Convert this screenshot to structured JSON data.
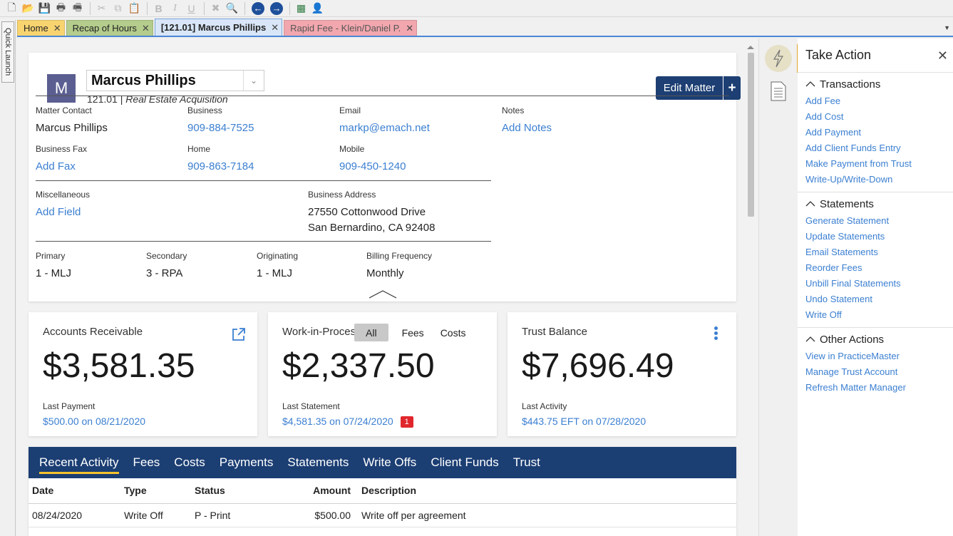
{
  "toolbar": {
    "buttons": [
      "new-doc-icon",
      "open-folder-icon",
      "save-icon",
      "print-icon",
      "print-multi-icon",
      "cut-icon",
      "copy-icon",
      "paste-icon",
      "bold-icon",
      "italic-icon",
      "underline-icon",
      "delete-icon",
      "find-icon",
      "back-arrow-icon",
      "forward-arrow-icon",
      "grid-icon",
      "user-key-icon"
    ]
  },
  "quick_launch": "Quick Launch",
  "tabs": [
    {
      "label": "Home"
    },
    {
      "label": "Recap of Hours"
    },
    {
      "label": "[121.01] Marcus Phillips"
    },
    {
      "label": "Rapid Fee - Klein/Daniel P."
    }
  ],
  "close_glyph": "✕",
  "matter": {
    "avatar": "M",
    "client_name": "Marcus Phillips",
    "number": "121.01",
    "separator": " | ",
    "description": "Real Estate Acquisition",
    "edit_label": "Edit Matter",
    "add_label": "+"
  },
  "contact": {
    "matter_contact": {
      "label": "Matter Contact",
      "value": "Marcus Phillips"
    },
    "business": {
      "label": "Business",
      "value": "909-884-7525"
    },
    "email": {
      "label": "Email",
      "value": "markp@emach.net"
    },
    "notes": {
      "label": "Notes",
      "value": "Add Notes"
    },
    "business_fax": {
      "label": "Business Fax",
      "value": "Add Fax"
    },
    "home": {
      "label": "Home",
      "value": "909-863-7184"
    },
    "mobile": {
      "label": "Mobile",
      "value": "909-450-1240"
    },
    "misc": {
      "label": "Miscellaneous",
      "value": "Add Field"
    },
    "address": {
      "label": "Business Address",
      "line1": "27550 Cottonwood Drive",
      "line2": "San Bernardino, CA 92408"
    },
    "primary": {
      "label": "Primary",
      "value": "1 - MLJ"
    },
    "secondary": {
      "label": "Secondary",
      "value": "3 - RPA"
    },
    "originating": {
      "label": "Originating",
      "value": "1 - MLJ"
    },
    "billing": {
      "label": "Billing Frequency",
      "value": "Monthly"
    }
  },
  "tiles": {
    "ar": {
      "title": "Accounts Receivable",
      "amount": "$3,581.35",
      "sub_label": "Last Payment",
      "sub_value": "$500.00 on 08/21/2020"
    },
    "wip": {
      "title": "Work-in-Process",
      "segments": [
        "All",
        "Fees",
        "Costs"
      ],
      "amount": "$2,337.50",
      "sub_label": "Last Statement",
      "sub_value": "$4,581.35 on 07/24/2020",
      "badge": "1"
    },
    "trust": {
      "title": "Trust Balance",
      "amount": "$7,696.49",
      "sub_label": "Last Activity",
      "sub_value": "$443.75 EFT on 07/28/2020"
    }
  },
  "activity": {
    "tabs": [
      "Recent Activity",
      "Fees",
      "Costs",
      "Payments",
      "Statements",
      "Write Offs",
      "Client Funds",
      "Trust"
    ],
    "columns": [
      "Date",
      "Type",
      "Status",
      "Amount",
      "Description"
    ],
    "rows": [
      {
        "date": "08/24/2020",
        "type": "Write Off",
        "status": "P - Print",
        "amount": "$500.00",
        "description": "Write off per agreement"
      }
    ]
  },
  "take_action": {
    "title": "Take Action",
    "sections": [
      {
        "title": "Transactions",
        "items": [
          "Add Fee",
          "Add Cost",
          "Add Payment",
          "Add Client Funds Entry",
          "Make Payment from Trust",
          "Write-Up/Write-Down"
        ]
      },
      {
        "title": "Statements",
        "items": [
          "Generate Statement",
          "Update Statements",
          "Email Statements",
          "Reorder Fees",
          "Unbill Final Statements",
          "Undo Statement",
          "Write Off"
        ]
      },
      {
        "title": "Other Actions",
        "items": [
          "View in PracticeMaster",
          "Manage Trust Account",
          "Refresh Matter Manager"
        ]
      }
    ]
  },
  "colors": {
    "accent_navy": "#1b3e73",
    "link": "#3b7fd1",
    "tab_active_underline": "#f4c22b",
    "badge_red": "#e0262c"
  }
}
